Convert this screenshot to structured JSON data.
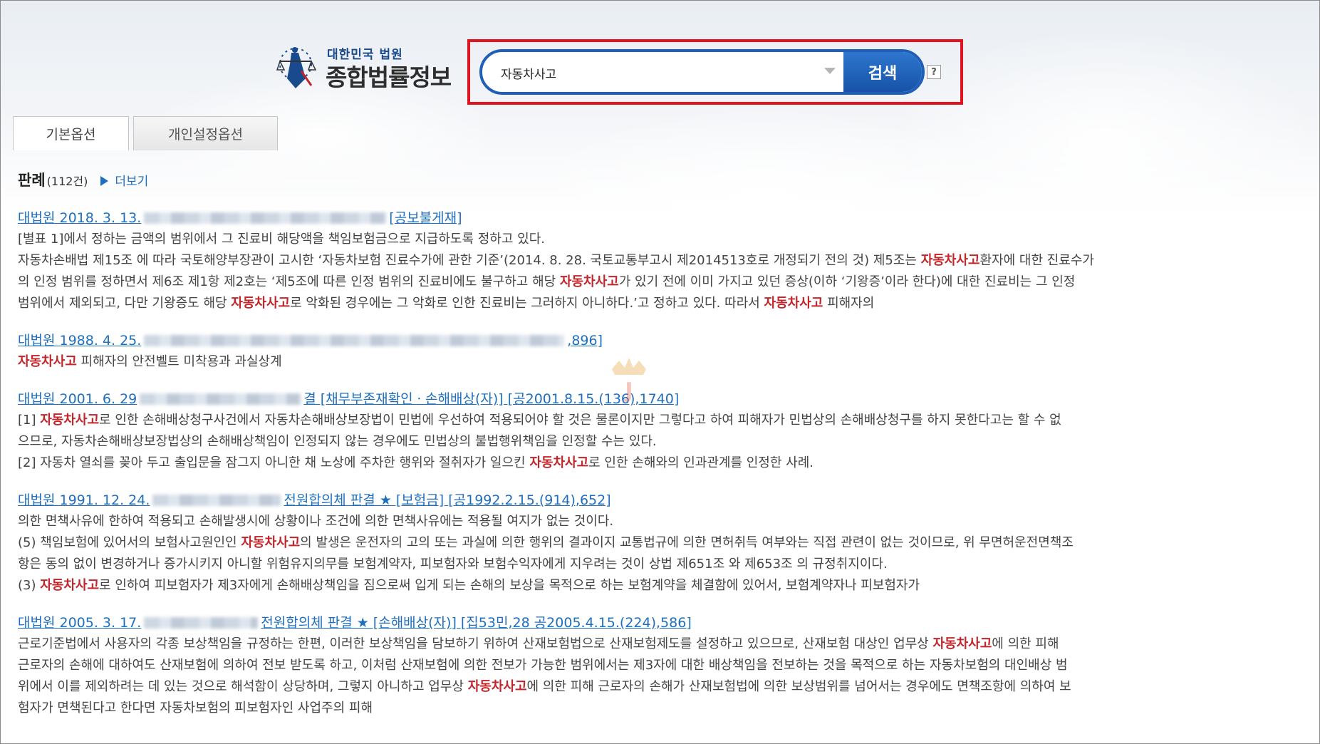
{
  "header": {
    "court_name": "대한민국 법원",
    "site_name": "종합법률정보",
    "search": {
      "value": "자동차사고",
      "button_label": "검색",
      "help_label": "?"
    }
  },
  "tabs": [
    {
      "label": "기본옵션",
      "active": true
    },
    {
      "label": "개인설정옵션",
      "active": false
    }
  ],
  "section": {
    "title": "판례",
    "count": "(112건)",
    "more_label": "더보기"
  },
  "keyword": "자동차사고",
  "results": [
    {
      "title_prefix": "대법원 2018. 3. 13.",
      "title_suffix": "[공보불게재]",
      "lines": [
        [
          {
            "t": "[별표 1]에서 정하는 금액의 범위에서 그 진료비 해당액을 책임보험금으로 지급하도록 정하고 있다."
          }
        ],
        [
          {
            "t": "자동차손배법 제15조 에 따라 국토해양부장관이 고시한 ‘자동차보험 진료수가에 관한 기준’(2014. 8. 28. 국토교통부고시 제2014513호로 개정되기 전의 것) 제5조는 "
          },
          {
            "t": "자동차사고",
            "k": true
          },
          {
            "t": "환자에 대한 진료수가"
          }
        ],
        [
          {
            "t": "의 인정 범위를 정하면서 제6조 제1항 제2호는 ‘제5조에 따른 인정 범위의 진료비에도 불구하고 해당 "
          },
          {
            "t": "자동차사고",
            "k": true
          },
          {
            "t": "가 있기 전에 이미 가지고 있던 증상(이하 ‘기왕증’이라 한다)에 대한 진료비는 그 인정"
          }
        ],
        [
          {
            "t": "범위에서 제외되고, 다만 기왕증도 해당 "
          },
          {
            "t": "자동차사고",
            "k": true
          },
          {
            "t": "로 악화된 경우에는 그 악화로 인한 진료비는 그러하지 아니하다.’고 정하고 있다. 따라서 "
          },
          {
            "t": "자동차사고",
            "k": true
          },
          {
            "t": " 피해자의"
          }
        ]
      ]
    },
    {
      "title_prefix": "대법원 1988. 4. 25.",
      "title_suffix": ",896]",
      "lines": [
        [
          {
            "t": "자동차사고",
            "k": true
          },
          {
            "t": " 피해자의 안전벨트 미착용과 과실상계"
          }
        ]
      ]
    },
    {
      "title_prefix": "대법원 2001. 6. 29",
      "title_suffix": "결 [채무부존재확인ㆍ손해배상(자)] [공2001.8.15.(136),1740]",
      "lines": [
        [
          {
            "t": "[1] "
          },
          {
            "t": "자동차사고",
            "k": true
          },
          {
            "t": "로 인한 손해배상청구사건에서 자동차손해배상보장법이 민법에 우선하여 적용되어야 할 것은 물론이지만 그렇다고 하여 피해자가 민법상의 손해배상청구를 하지 못한다고는 할 수 없"
          }
        ],
        [
          {
            "t": "으므로, 자동차손해배상보장법상의 손해배상책임이 인정되지 않는 경우에도 민법상의 불법행위책임을 인정할 수는 있다."
          }
        ],
        [
          {
            "t": "[2] 자동차 열쇠를 꽂아 두고 출입문을 잠그지 아니한 채 노상에 주차한 행위와 절취자가 일으킨 "
          },
          {
            "t": "자동차사고",
            "k": true
          },
          {
            "t": "로 인한 손해와의 인과관계를 인정한 사례."
          }
        ]
      ]
    },
    {
      "title_prefix": "대법원 1991. 12. 24.",
      "title_suffix": "전원합의체 판결 ★ [보험금] [공1992.2.15.(914),652]",
      "lines": [
        [
          {
            "t": "의한 면책사유에 한하여 적용되고 손해발생시에 상황이나 조건에 의한 면책사유에는 적용될 여지가 없는 것이다."
          }
        ],
        [
          {
            "t": "(5) 책임보험에 있어서의 보험사고원인인 "
          },
          {
            "t": "자동차사고",
            "k": true
          },
          {
            "t": "의 발생은 운전자의 고의 또는 과실에 의한 행위의 결과이지 교통법규에 의한 면허취득 여부와는 직접 관련이 없는 것이므로, 위 무면허운전면책조"
          }
        ],
        [
          {
            "t": "항은 동의 없이 변경하거나 증가시키지 아니할 위험유지의무를 보험계약자, 피보험자와 보험수익자에게 지우려는 것이 상법 제651조 와 제653조 의 규정취지이다."
          }
        ],
        [
          {
            "t": "(3) "
          },
          {
            "t": "자동차사고",
            "k": true
          },
          {
            "t": "로 인하여 피보험자가 제3자에게 손해배상책임을 짐으로써 입게 되는 손해의 보상을 목적으로 하는 보험계약을 체결함에 있어서, 보험계약자나 피보험자가"
          }
        ]
      ]
    },
    {
      "title_prefix": "대법원 2005. 3. 17.",
      "title_suffix": "전원합의체 판결 ★ [손해배상(자)] [집53민,28 공2005.4.15.(224),586]",
      "lines": [
        [
          {
            "t": "근로기준법에서 사용자의 각종 보상책임을 규정하는 한편, 이러한 보상책임을 담보하기 위하여 산재보험법으로 산재보험제도를 설정하고 있으므로, 산재보험 대상인 업무상 "
          },
          {
            "t": "자동차사고",
            "k": true
          },
          {
            "t": "에 의한 피해"
          }
        ],
        [
          {
            "t": "근로자의 손해에 대하여도 산재보험에 의하여 전보 받도록 하고, 이처럼 산재보험에 의한 전보가 가능한 범위에서는 제3자에 대한 배상책임을 전보하는 것을 목적으로 하는 자동차보험의 대인배상 범"
          }
        ],
        [
          {
            "t": "위에서 이를 제외하려는 데 있는 것으로 해석함이 상당하며, 그렇지 아니하고 업무상 "
          },
          {
            "t": "자동차사고",
            "k": true
          },
          {
            "t": "에 의한 피해 근로자의 손해가 산재보험법에 의한 보상범위를 넘어서는 경우에도 면책조항에 의하여 보"
          }
        ],
        [
          {
            "t": "험자가 면책된다고 한다면 자동차보험의 피보험자인 사업주의 피해"
          }
        ]
      ]
    }
  ],
  "colors": {
    "link": "#1f6fbf",
    "keyword": "#c2262b",
    "highlight_box": "#e0141e",
    "search_border": "#1f5fb8"
  }
}
